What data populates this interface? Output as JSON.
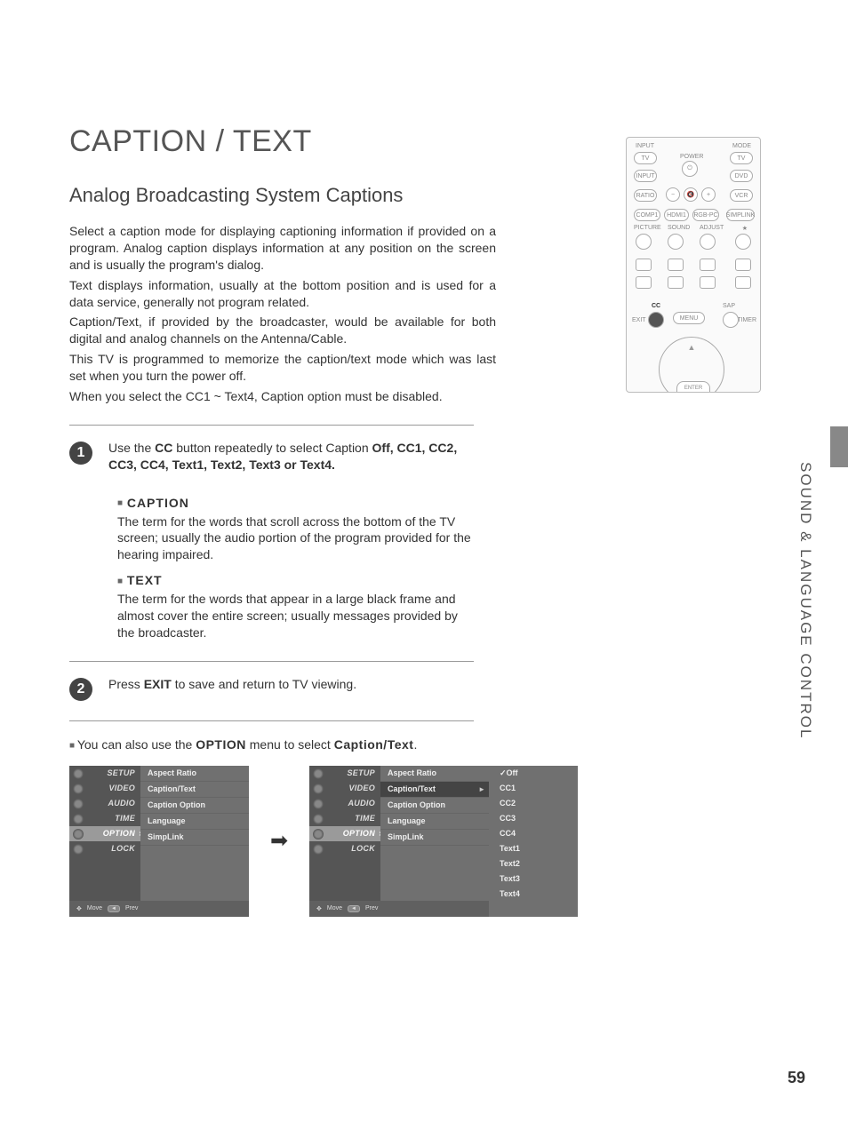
{
  "title": "CAPTION / TEXT",
  "subtitle": "Analog Broadcasting System Captions",
  "paragraphs": {
    "p1": "Select a caption mode for displaying captioning information if provided on a program. Analog caption displays information at any position on the screen and is usually the program's dialog.",
    "p2": "Text displays information, usually at the bottom position and is used for a data service, generally not program related.",
    "p3": "Caption/Text, if provided by the broadcaster, would be available for both digital and analog channels on the Antenna/Cable.",
    "p4": "This TV is programmed to memorize the caption/text mode which was last set when you turn the power off.",
    "p5": "When you select the CC1 ~ Text4, Caption option must be disabled."
  },
  "step1": {
    "num": "1",
    "pre": "Use the ",
    "btn": "CC",
    "mid": " button repeatedly to select Caption ",
    "opts": "Off, CC1, CC2, CC3, CC4, Text1, Text2, Text3 or Text4."
  },
  "caption_block": {
    "head": "CAPTION",
    "body": "The term for the words that scroll across the bottom of the TV screen; usually the audio portion of the program provided for the hearing impaired."
  },
  "text_block": {
    "head": "TEXT",
    "body": "The term for the words that appear in a large black frame and almost cover the entire screen; usually messages provided by the broadcaster."
  },
  "step2": {
    "num": "2",
    "pre": "Press ",
    "btn": "EXIT",
    "post": " to save and return to TV viewing."
  },
  "also": {
    "pre": "You can also use the ",
    "btn": "OPTION",
    "mid": " menu to select ",
    "target": "Caption/Text",
    "post": "."
  },
  "side_label": "SOUND & LANGUAGE CONTROL",
  "page_number": "59",
  "remote": {
    "input": "INPUT",
    "mode": "MODE",
    "power": "POWER",
    "tv": "TV",
    "dvd": "DVD",
    "vcr": "VCR",
    "ratio": "RATIO",
    "comp1": "COMP1",
    "hdmi1": "HDMI1",
    "rgbpc": "RGB-PC",
    "simplink": "SIMPLINK",
    "picture": "PICTURE",
    "sound": "SOUND",
    "adjust": "ADJUST",
    "star": "★",
    "cc": "CC",
    "menu": "MENU",
    "sap": "SAP",
    "exit": "EXIT",
    "timer": "TIMER",
    "enter": "ENTER",
    "input2": "INPUT"
  },
  "menu": {
    "tabs": [
      "SETUP",
      "VIDEO",
      "AUDIO",
      "TIME",
      "OPTION",
      "LOCK"
    ],
    "items": [
      "Aspect Ratio",
      "Caption/Text",
      "Caption Option",
      "Language",
      "SimpLink"
    ],
    "options": [
      "Off",
      "CC1",
      "CC2",
      "CC3",
      "CC4",
      "Text1",
      "Text2",
      "Text3",
      "Text4"
    ],
    "foot_move": "Move",
    "foot_prev": "Prev"
  }
}
